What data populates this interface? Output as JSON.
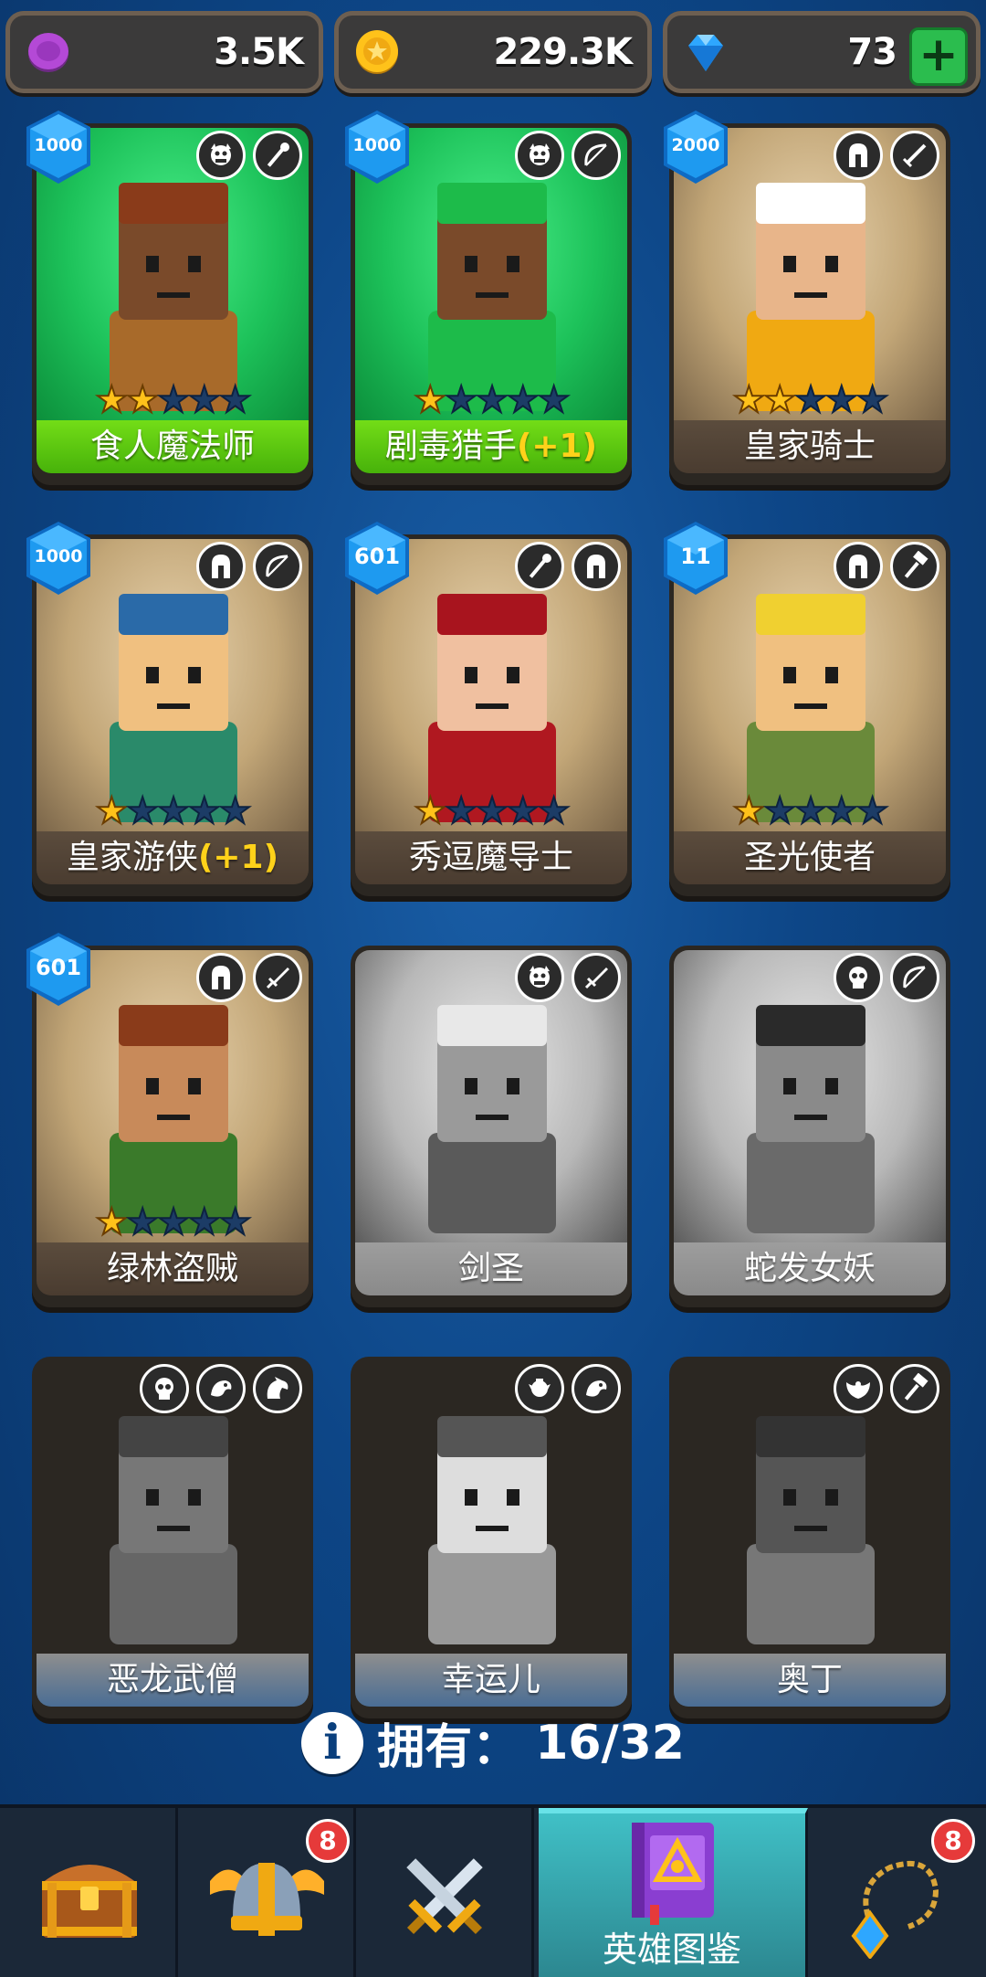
{
  "currencies": {
    "orb": "3.5K",
    "coins": "229.3K",
    "gems": "73",
    "add_label": "+"
  },
  "heroes": [
    {
      "name": "食人魔法师",
      "plus": "",
      "level": "1000",
      "stars": 2,
      "owned": true,
      "style": "green",
      "roles": [
        "ogre-icon",
        "staff-icon"
      ]
    },
    {
      "name": "剧毒猎手",
      "plus": "(+1)",
      "level": "1000",
      "stars": 1,
      "owned": true,
      "style": "green",
      "roles": [
        "ogre-icon",
        "bow-icon"
      ]
    },
    {
      "name": "皇家骑士",
      "plus": "",
      "level": "2000",
      "stars": 2,
      "owned": true,
      "style": "brown",
      "roles": [
        "helmet-icon",
        "sword-icon"
      ]
    },
    {
      "name": "皇家游侠",
      "plus": "(+1)",
      "level": "1000",
      "stars": 1,
      "owned": true,
      "style": "brown",
      "roles": [
        "helmet-icon",
        "bow-icon"
      ]
    },
    {
      "name": "秀逗魔导士",
      "plus": "",
      "level": "601",
      "stars": 1,
      "owned": true,
      "style": "brown",
      "roles": [
        "staff-icon",
        "helmet-icon"
      ]
    },
    {
      "name": "圣光使者",
      "plus": "",
      "level": "11",
      "stars": 1,
      "owned": true,
      "style": "brown",
      "roles": [
        "helmet-icon",
        "hammer-icon"
      ]
    },
    {
      "name": "绿林盗贼",
      "plus": "",
      "level": "601",
      "stars": 1,
      "owned": true,
      "style": "brown",
      "roles": [
        "helmet-icon",
        "dagger-icon"
      ]
    },
    {
      "name": "剑圣",
      "plus": "",
      "level": "",
      "stars": 0,
      "owned": false,
      "style": "gray",
      "roles": [
        "ogre-icon",
        "dagger-icon"
      ]
    },
    {
      "name": "蛇发女妖",
      "plus": "",
      "level": "",
      "stars": 0,
      "owned": false,
      "style": "gray",
      "roles": [
        "skull-icon",
        "bow-icon"
      ]
    },
    {
      "name": "恶龙武僧",
      "plus": "",
      "level": "",
      "stars": 0,
      "owned": false,
      "style": "faded",
      "roles": [
        "skull-icon",
        "beast-icon",
        "dragon-icon"
      ]
    },
    {
      "name": "幸运儿",
      "plus": "",
      "level": "",
      "stars": 0,
      "owned": false,
      "style": "faded",
      "roles": [
        "elf-icon",
        "beast-icon"
      ]
    },
    {
      "name": "奥丁",
      "plus": "",
      "level": "",
      "stars": 0,
      "owned": false,
      "style": "faded",
      "roles": [
        "wings-icon",
        "hammer-icon"
      ]
    }
  ],
  "owned_summary": {
    "label": "拥有：",
    "count": "16/32"
  },
  "nav": {
    "tabs": [
      {
        "id": "chest",
        "label": "",
        "badge": ""
      },
      {
        "id": "heroes",
        "label": "",
        "badge": "8"
      },
      {
        "id": "battle",
        "label": "",
        "badge": ""
      },
      {
        "id": "codex",
        "label": "英雄图鉴",
        "badge": ""
      },
      {
        "id": "amulet",
        "label": "",
        "badge": "8"
      }
    ],
    "active": "codex"
  },
  "colors": {
    "background": "#0a3f7c",
    "owned_green": "#47b20a",
    "star": "#ffc21a",
    "badge_blue": "#1e9af0",
    "nav_active": "#40c0c6",
    "notify_red": "#e63a3a"
  }
}
